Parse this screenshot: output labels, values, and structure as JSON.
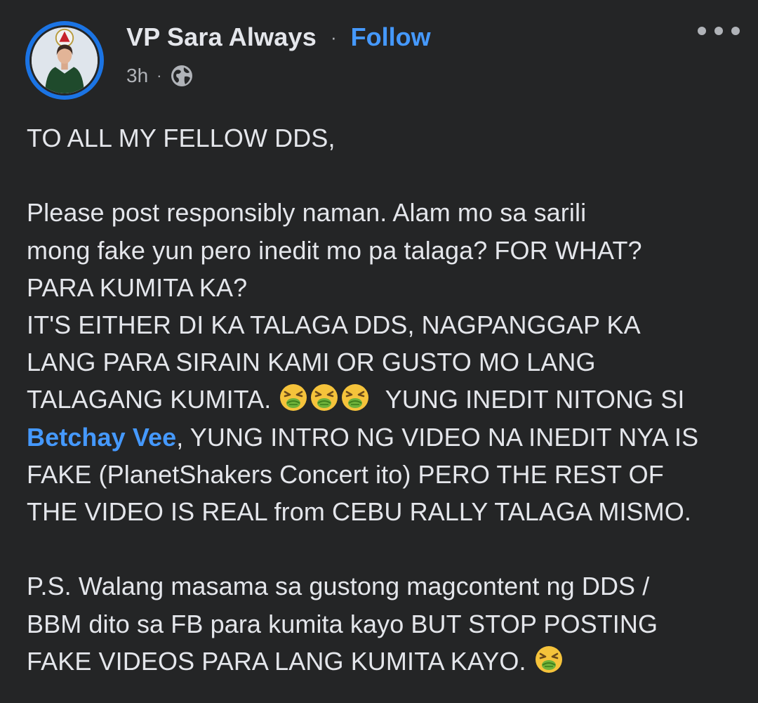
{
  "post": {
    "author": "VP Sara Always",
    "separator": "·",
    "follow_label": "Follow",
    "timestamp": "3h",
    "meta_separator": "·",
    "audience_icon": "globe-icon",
    "more_icon": "more-options-icon",
    "accent_color": "#4599ff",
    "background_color": "#242526",
    "body": {
      "line1": "TO ALL MY FELLOW DDS,",
      "line2": "Please post responsibly naman. Alam mo sa sarili",
      "line3": "mong fake yun pero inedit mo pa talaga? FOR WHAT?",
      "line4": "PARA KUMITA KA?",
      "line5": "IT'S EITHER DI KA TALAGA DDS, NAGPANGGAP KA",
      "line6": "LANG PARA SIRAIN KAMI OR GUSTO MO LANG",
      "line7_a": "TALAGANG KUMITA.",
      "line7_b": "YUNG INEDIT NITONG SI",
      "mention": "Betchay Vee",
      "line8_b": ", YUNG INTRO NG VIDEO NA INEDIT NYA IS",
      "line9": "FAKE (PlanetShakers Concert ito) PERO THE REST OF",
      "line10": "THE VIDEO IS REAL from CEBU RALLY TALAGA MISMO.",
      "line11": "P.S. Walang masama sa gustong magcontent ng DDS /",
      "line12": "BBM dito sa FB para kumita kayo BUT STOP POSTING",
      "line13": "FAKE VIDEOS PARA LANG KUMITA KAYO.",
      "emoji_name": "nauseated-face-emoji"
    }
  }
}
